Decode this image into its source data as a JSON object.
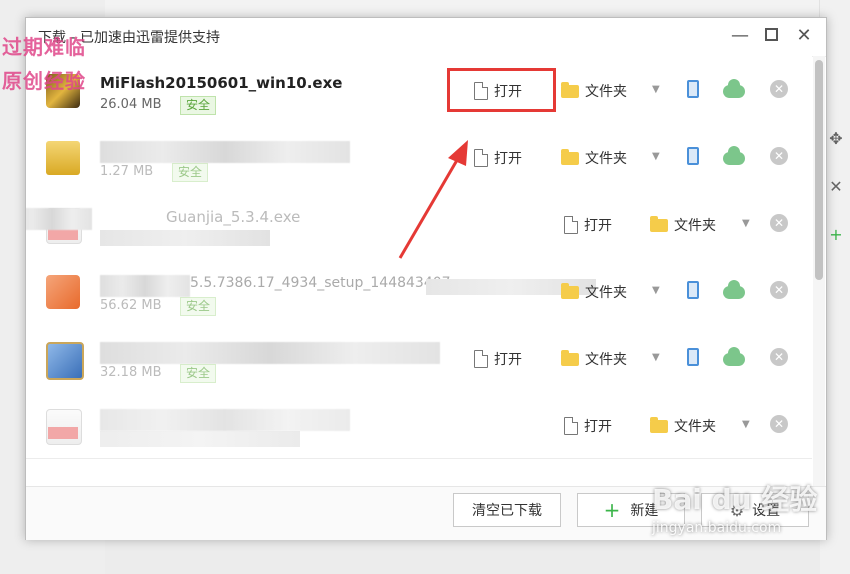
{
  "window": {
    "title": "下载 - 已加速由迅雷提供支持",
    "minimize": "—",
    "close": "✕"
  },
  "watermark": {
    "top_left_line1": "过期难临",
    "top_left_line2": "原创经验",
    "brand": "Bai du 经验",
    "url": "jingyan.baidu.com"
  },
  "rows": [
    {
      "name": "MiFlash20150601_win10.exe",
      "size": "26.04 MB",
      "badge": "安全"
    },
    {
      "name": "",
      "size": "1.27 MB",
      "badge": "安全"
    },
    {
      "name": "Guanjia_5.3.4.exe",
      "size": "",
      "badge": ""
    },
    {
      "name": "5.5.7386.17_4934_setup_144843407",
      "size": "56.62 MB",
      "badge": "安全"
    },
    {
      "name": "",
      "size": "32.18 MB",
      "badge": "安全"
    },
    {
      "name": "",
      "size": "",
      "badge": ""
    }
  ],
  "actions": {
    "open": "打开",
    "folder": "文件夹",
    "dropdown": "▼",
    "delete": "✕"
  },
  "footer": {
    "clear_label": "清空已下载",
    "new_label": "新建",
    "settings_label": "设置"
  },
  "colors": {
    "highlight": "#e53935",
    "safe_green": "#5aa53c",
    "cloud_green": "#7cc68b",
    "phone_blue": "#4a90d9",
    "folder_yellow": "#f5cc4a"
  }
}
